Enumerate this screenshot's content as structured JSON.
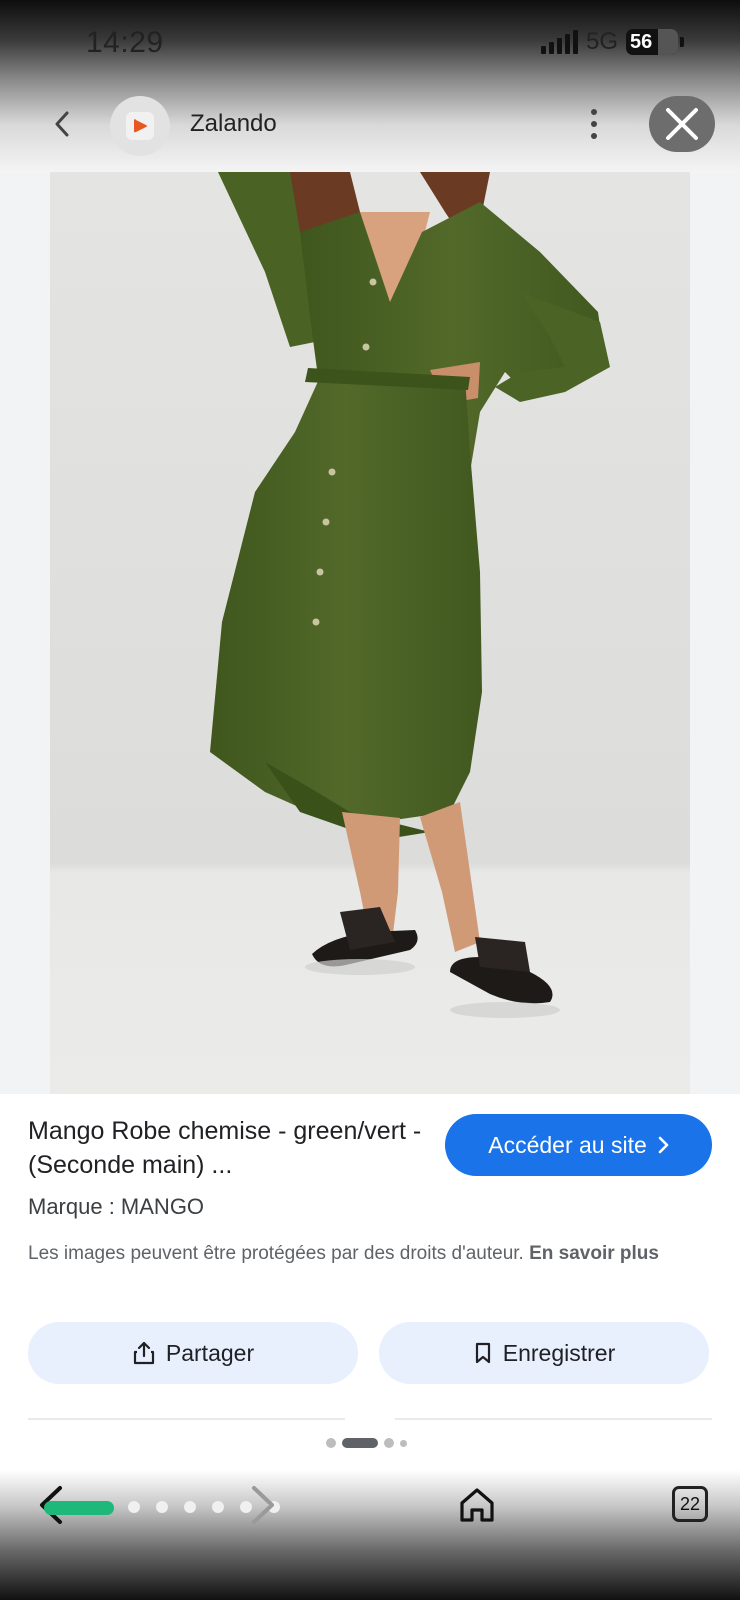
{
  "status_bar": {
    "time": "14:29",
    "network": "5G",
    "battery": "56"
  },
  "header": {
    "site_name": "Zalando",
    "icons": [
      "chevron-left-icon",
      "zalando-logo-icon",
      "more-vert-icon",
      "close-icon"
    ]
  },
  "product": {
    "title": "Mango Robe chemise - green/vert - (Seconde main) ...",
    "visit_label": "Accéder au site",
    "brand": "Marque : MANGO",
    "copyright_text": "Les images peuvent être protégées par des droits d'auteur.",
    "learn_more": "En savoir plus"
  },
  "actions": {
    "share_label": "Partager",
    "save_label": "Enregistrer"
  },
  "carousel": {
    "count": 4,
    "active_index": 1
  },
  "bottom_nav": {
    "tabs_count": "22"
  },
  "colors": {
    "accent": "#1a73e8",
    "action_bg": "#e8f0fe",
    "progress": "#1db87a",
    "dress": "#4b6324"
  }
}
